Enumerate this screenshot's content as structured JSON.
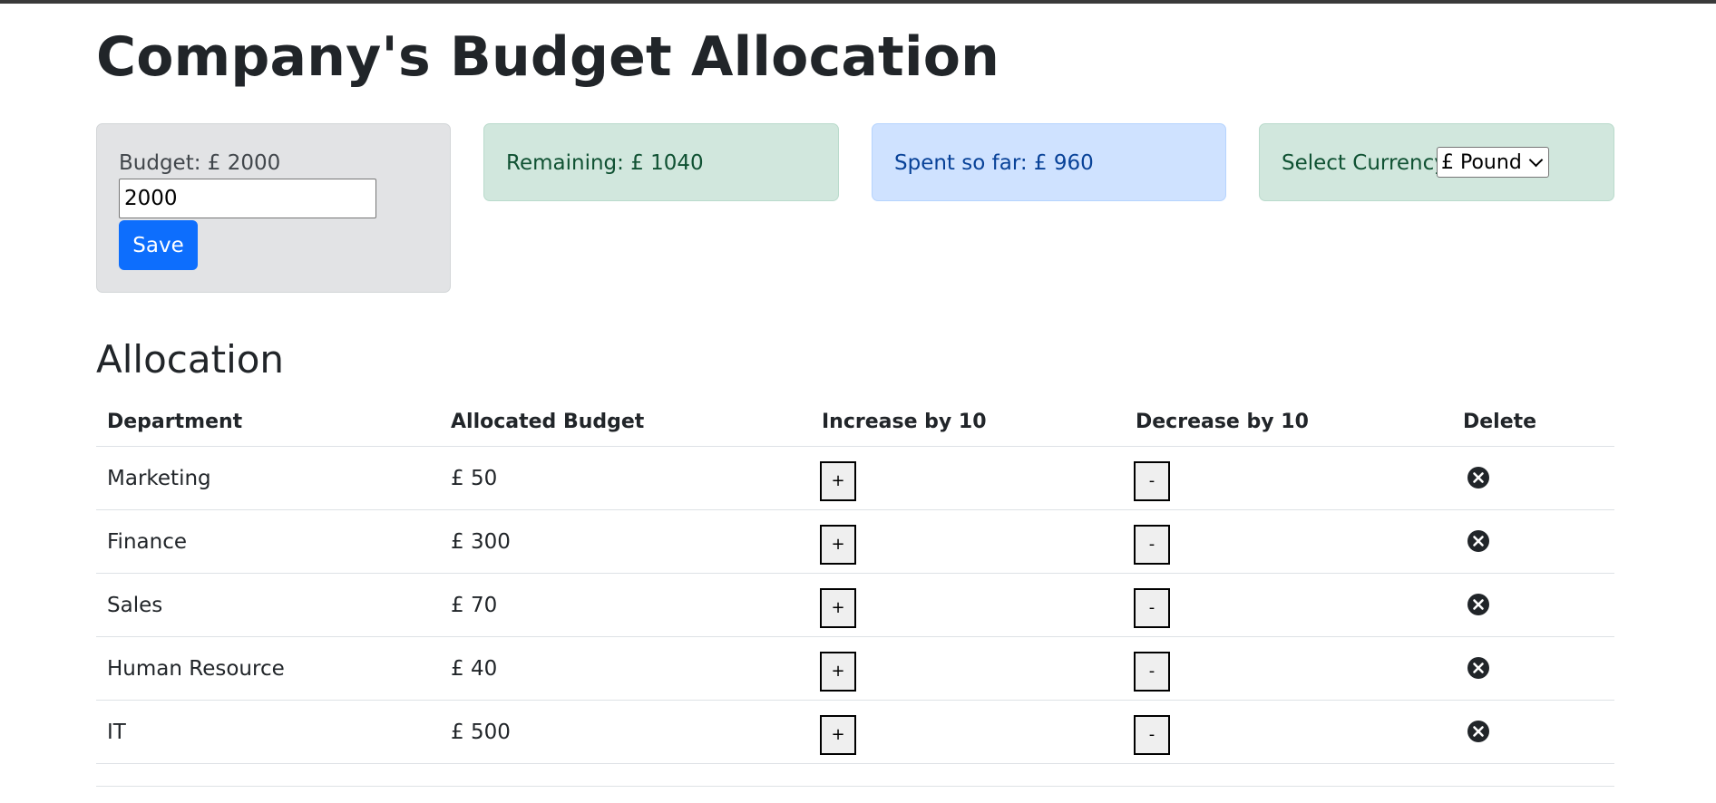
{
  "page": {
    "title": "Company's Budget Allocation"
  },
  "budget": {
    "label": "Budget: £ 2000",
    "input_value": "2000",
    "save_label": "Save"
  },
  "remaining": {
    "label": "Remaining: £ 1040"
  },
  "spent": {
    "label": "Spent so far: £ 960"
  },
  "currency": {
    "label": "Select Currency:",
    "selected": "£ Pound"
  },
  "allocation": {
    "title": "Allocation",
    "headers": {
      "department": "Department",
      "allocated": "Allocated Budget",
      "increase": "Increase by 10",
      "decrease": "Decrease by 10",
      "delete": "Delete"
    },
    "increase_symbol": "+",
    "decrease_symbol": "-",
    "rows": [
      {
        "department": "Marketing",
        "allocated": "£ 50"
      },
      {
        "department": "Finance",
        "allocated": "£ 300"
      },
      {
        "department": "Sales",
        "allocated": "£ 70"
      },
      {
        "department": "Human Resource",
        "allocated": "£ 40"
      },
      {
        "department": "IT",
        "allocated": "£ 500"
      }
    ]
  },
  "icons": {
    "delete": "close-circle-icon",
    "select": "chevron-down-icon"
  },
  "colors": {
    "primary": "#0d6efd",
    "success_bg": "#d1e7dd",
    "primary_bg": "#cfe2ff",
    "secondary_bg": "#e2e3e5"
  }
}
